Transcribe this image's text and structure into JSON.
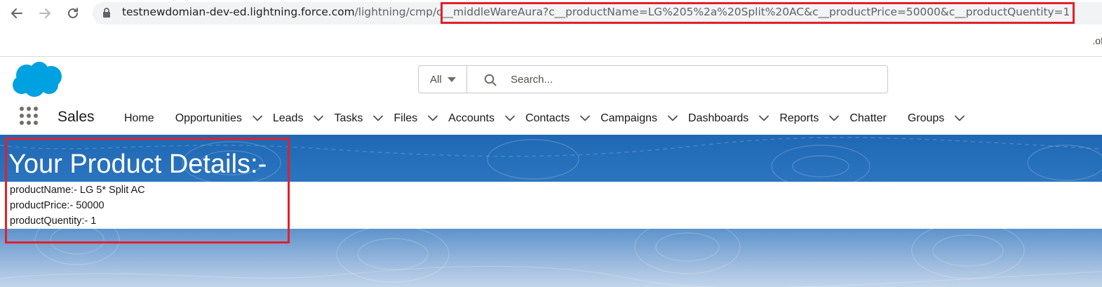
{
  "browser": {
    "url_host": "testnewdomian-dev-ed.lightning.force.com",
    "url_path": "/lightning/cmp/c__middleWareAura?c__productName=LG%205%2a%20Split%20AC&c__productPrice=50000&c__productQuentity=1",
    "back_icon": "back-arrow-icon",
    "forward_icon": "forward-arrow-icon",
    "reload_icon": "reload-icon",
    "lock_icon": "lock-icon",
    "highlight_color": "#e3202b"
  },
  "page_top_right_text": ".of",
  "header": {
    "logo": "salesforce-cloud-logo",
    "search_scope": "All",
    "search_placeholder": "Search..."
  },
  "app_nav": {
    "app_name": "Sales",
    "items": [
      {
        "label": "Home",
        "has_menu": false
      },
      {
        "label": "Opportunities",
        "has_menu": true
      },
      {
        "label": "Leads",
        "has_menu": true
      },
      {
        "label": "Tasks",
        "has_menu": true
      },
      {
        "label": "Files",
        "has_menu": true
      },
      {
        "label": "Accounts",
        "has_menu": true
      },
      {
        "label": "Contacts",
        "has_menu": true
      },
      {
        "label": "Campaigns",
        "has_menu": true
      },
      {
        "label": "Dashboards",
        "has_menu": true
      },
      {
        "label": "Reports",
        "has_menu": true
      },
      {
        "label": "Chatter",
        "has_menu": false
      },
      {
        "label": "Groups",
        "has_menu": true
      }
    ]
  },
  "product": {
    "title": "Your Product Details:-",
    "name_line": "productName:- LG 5* Split AC",
    "price_line": "productPrice:- 50000",
    "quantity_line": "productQuentity:- 1"
  },
  "colors": {
    "brand_blue": "#1f68b4",
    "salesforce_cloud": "#00a1e0"
  }
}
